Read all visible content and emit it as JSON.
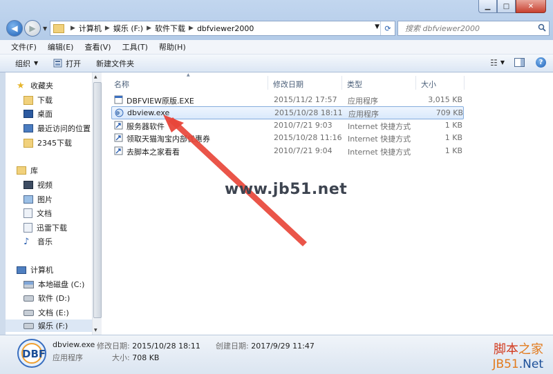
{
  "address": {
    "breadcrumbs": [
      "计算机",
      "娱乐 (F:)",
      "软件下载",
      "dbfviewer2000"
    ]
  },
  "search": {
    "placeholder": "搜索 dbfviewer2000"
  },
  "menubar": [
    "文件(F)",
    "编辑(E)",
    "查看(V)",
    "工具(T)",
    "帮助(H)"
  ],
  "toolbar": {
    "organize": "组织",
    "open": "打开",
    "new_folder": "新建文件夹"
  },
  "sidebar": {
    "favorites": {
      "label": "收藏夹",
      "items": [
        "下载",
        "桌面",
        "最近访问的位置",
        "2345下载"
      ]
    },
    "libraries": {
      "label": "库",
      "items": [
        "视频",
        "图片",
        "文档",
        "迅雷下载",
        "音乐"
      ]
    },
    "computer": {
      "label": "计算机",
      "items": [
        "本地磁盘 (C:)",
        "软件 (D:)",
        "文档 (E:)",
        "娱乐 (F:)"
      ]
    }
  },
  "columns": {
    "name": "名称",
    "date": "修改日期",
    "type": "类型",
    "size": "大小"
  },
  "files": [
    {
      "name": "DBFVIEW原版.EXE",
      "date": "2015/11/2 17:57",
      "type": "应用程序",
      "size": "3,015 KB",
      "icon": "exe-icon",
      "selected": false
    },
    {
      "name": "dbview.exe",
      "date": "2015/10/28 18:11",
      "type": "应用程序",
      "size": "709 KB",
      "icon": "dbf-app-icon",
      "selected": true
    },
    {
      "name": "服务器软件",
      "date": "2010/7/21 9:03",
      "type": "Internet 快捷方式",
      "size": "1 KB",
      "icon": "shortcut-icon",
      "selected": false
    },
    {
      "name": "领取天猫淘宝内部优惠券",
      "date": "2015/10/28 11:16",
      "type": "Internet 快捷方式",
      "size": "1 KB",
      "icon": "shortcut-icon",
      "selected": false
    },
    {
      "name": "去脚本之家看看",
      "date": "2010/7/21 9:04",
      "type": "Internet 快捷方式",
      "size": "1 KB",
      "icon": "shortcut-icon",
      "selected": false
    }
  ],
  "watermark": "www.jb51.net",
  "details": {
    "filename": "dbview.exe",
    "modified_label": "修改日期:",
    "modified": "2015/10/28 18:11",
    "created_label": "创建日期:",
    "created": "2017/9/29 11:47",
    "type": "应用程序",
    "size_label": "大小:",
    "size": "708 KB"
  },
  "brand": {
    "cn_a": "脚本",
    "cn_b": "之家",
    "en_a": "JB51",
    "en_b": ".Net"
  },
  "colors": {
    "accent": "#1c5fb6",
    "selection": "#d9e9fc",
    "arrow": "#e8463a"
  }
}
